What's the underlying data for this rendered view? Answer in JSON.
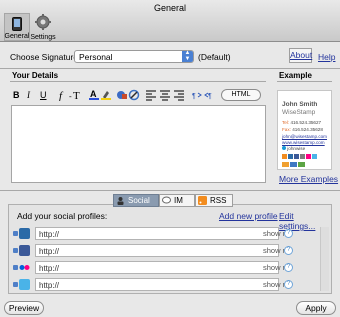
{
  "window": {
    "title": "General"
  },
  "toolbar_tabs": [
    {
      "label": "General",
      "icon": "phone-icon"
    },
    {
      "label": "Settings",
      "icon": "gear-icon"
    }
  ],
  "signature": {
    "label": "Choose Signature",
    "selected": "Personal",
    "suffix": "(Default)",
    "about_label": "About",
    "help_label": "Help"
  },
  "details": {
    "heading": "Your Details",
    "format_buttons": [
      "B",
      "I",
      "U"
    ],
    "html_label": "HTML"
  },
  "example": {
    "heading": "Example",
    "name": "John Smith",
    "company": "WiseStamp",
    "tel_key": "Tel:",
    "tel": "416.524.35627",
    "fax_key": "Fax:",
    "fax": "416.524.35628",
    "email": "john@wisestamp.com",
    "site": "www.wisestamp.com",
    "skype": "johnwise",
    "more_label": "More Examples"
  },
  "tabs": [
    {
      "label": "Social",
      "icon": "person-icon",
      "active": true
    },
    {
      "label": "IM",
      "icon": "chat-bubble-icon",
      "active": false
    },
    {
      "label": "RSS",
      "icon": "rss-icon",
      "active": false
    }
  ],
  "social": {
    "heading": "Add your social profiles:",
    "add_label": "Add new profile",
    "edit_label": "Edit settings...",
    "profiles": [
      {
        "network": "linkedin-icon",
        "placeholder": "http://",
        "show": "show m",
        "color": "#2b6aa7"
      },
      {
        "network": "facebook-icon",
        "placeholder": "http://",
        "show": "show m",
        "color": "#3b5998"
      },
      {
        "network": "flickr-icon",
        "placeholder": "http://",
        "show": "show m",
        "color": "#ff0084"
      },
      {
        "network": "twitter-icon",
        "placeholder": "http://",
        "show": "show m",
        "color": "#4ab3e8"
      }
    ]
  },
  "footer": {
    "preview_label": "Preview",
    "apply_label": "Apply"
  }
}
